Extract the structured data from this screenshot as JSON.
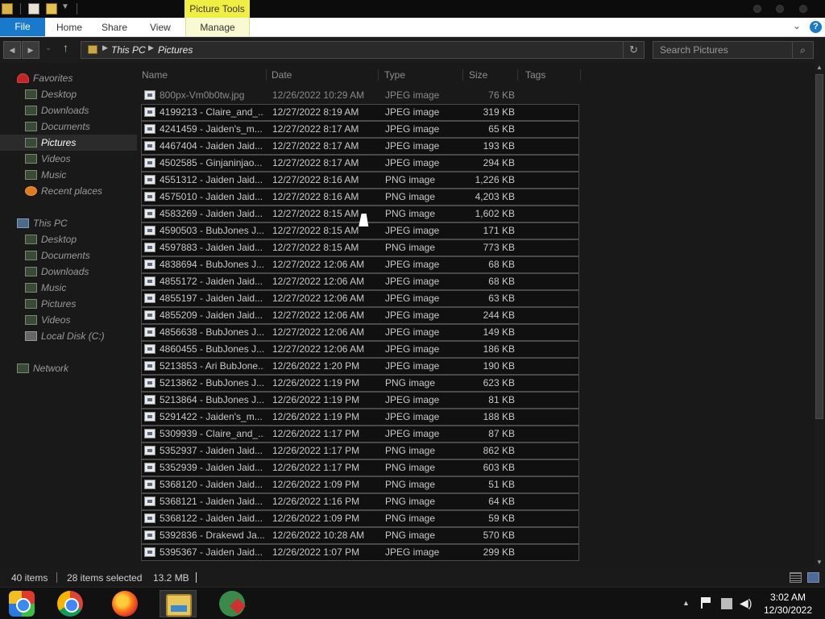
{
  "titlebar": {
    "contextual_tab": "Picture Tools"
  },
  "ribbon": {
    "file_label": "File",
    "tabs": [
      {
        "label": "Home"
      },
      {
        "label": "Share"
      },
      {
        "label": "View"
      },
      {
        "label": "Manage"
      }
    ],
    "help_label": "?"
  },
  "address": {
    "crumbs": [
      {
        "label": "This PC"
      },
      {
        "label": "Pictures"
      }
    ],
    "search_placeholder": "Search Pictures"
  },
  "nav": {
    "favorites_label": "Favorites",
    "favorites": [
      {
        "label": "Desktop"
      },
      {
        "label": "Downloads"
      },
      {
        "label": "Documents"
      },
      {
        "label": "Pictures"
      },
      {
        "label": "Videos"
      },
      {
        "label": "Music"
      },
      {
        "label": "Recent places"
      }
    ],
    "thispc_label": "This PC",
    "thispc": [
      {
        "label": "Desktop"
      },
      {
        "label": "Documents"
      },
      {
        "label": "Downloads"
      },
      {
        "label": "Music"
      },
      {
        "label": "Pictures"
      },
      {
        "label": "Videos"
      },
      {
        "label": "Local Disk (C:)"
      }
    ],
    "network_label": "Network"
  },
  "columns": {
    "name": "Name",
    "date": "Date",
    "type": "Type",
    "size": "Size",
    "tags": "Tags"
  },
  "files": [
    {
      "name": "800px-Vm0b0tw.jpg",
      "date": "12/26/2022 10:29 AM",
      "type": "JPEG image",
      "size": "76 KB",
      "selected": false
    },
    {
      "name": "4199213 - Claire_and_...",
      "date": "12/27/2022 8:19 AM",
      "type": "JPEG image",
      "size": "319 KB",
      "selected": true
    },
    {
      "name": "4241459 - Jaiden's_m...",
      "date": "12/27/2022 8:17 AM",
      "type": "JPEG image",
      "size": "65 KB",
      "selected": true
    },
    {
      "name": "4467404 - Jaiden Jaid...",
      "date": "12/27/2022 8:17 AM",
      "type": "JPEG image",
      "size": "193 KB",
      "selected": true
    },
    {
      "name": "4502585 - Ginjaninjao...",
      "date": "12/27/2022 8:17 AM",
      "type": "JPEG image",
      "size": "294 KB",
      "selected": true
    },
    {
      "name": "4551312 - Jaiden Jaid...",
      "date": "12/27/2022 8:16 AM",
      "type": "PNG image",
      "size": "1,226 KB",
      "selected": true
    },
    {
      "name": "4575010 - Jaiden Jaid...",
      "date": "12/27/2022 8:16 AM",
      "type": "PNG image",
      "size": "4,203 KB",
      "selected": true
    },
    {
      "name": "4583269 - Jaiden Jaid...",
      "date": "12/27/2022 8:15 AM",
      "type": "PNG image",
      "size": "1,602 KB",
      "selected": true
    },
    {
      "name": "4590503 - BubJones J...",
      "date": "12/27/2022 8:15 AM",
      "type": "JPEG image",
      "size": "171 KB",
      "selected": true
    },
    {
      "name": "4597883 - Jaiden Jaid...",
      "date": "12/27/2022 8:15 AM",
      "type": "PNG image",
      "size": "773 KB",
      "selected": true
    },
    {
      "name": "4838694 - BubJones J...",
      "date": "12/27/2022 12:06 AM",
      "type": "JPEG image",
      "size": "68 KB",
      "selected": true
    },
    {
      "name": "4855172 - Jaiden Jaid...",
      "date": "12/27/2022 12:06 AM",
      "type": "JPEG image",
      "size": "68 KB",
      "selected": true
    },
    {
      "name": "4855197 - Jaiden Jaid...",
      "date": "12/27/2022 12:06 AM",
      "type": "JPEG image",
      "size": "63 KB",
      "selected": true
    },
    {
      "name": "4855209 - Jaiden Jaid...",
      "date": "12/27/2022 12:06 AM",
      "type": "JPEG image",
      "size": "244 KB",
      "selected": true
    },
    {
      "name": "4856638 - BubJones J...",
      "date": "12/27/2022 12:06 AM",
      "type": "JPEG image",
      "size": "149 KB",
      "selected": true
    },
    {
      "name": "4860455 - BubJones J...",
      "date": "12/27/2022 12:06 AM",
      "type": "JPEG image",
      "size": "186 KB",
      "selected": true
    },
    {
      "name": "5213853 - Ari BubJone...",
      "date": "12/26/2022 1:20 PM",
      "type": "JPEG image",
      "size": "190 KB",
      "selected": true
    },
    {
      "name": "5213862 - BubJones J...",
      "date": "12/26/2022 1:19 PM",
      "type": "PNG image",
      "size": "623 KB",
      "selected": true
    },
    {
      "name": "5213864 - BubJones J...",
      "date": "12/26/2022 1:19 PM",
      "type": "JPEG image",
      "size": "81 KB",
      "selected": true
    },
    {
      "name": "5291422 - Jaiden's_m...",
      "date": "12/26/2022 1:19 PM",
      "type": "JPEG image",
      "size": "188 KB",
      "selected": true
    },
    {
      "name": "5309939 - Claire_and_...",
      "date": "12/26/2022 1:17 PM",
      "type": "JPEG image",
      "size": "87 KB",
      "selected": true
    },
    {
      "name": "5352937 - Jaiden Jaid...",
      "date": "12/26/2022 1:17 PM",
      "type": "PNG image",
      "size": "862 KB",
      "selected": true
    },
    {
      "name": "5352939 - Jaiden Jaid...",
      "date": "12/26/2022 1:17 PM",
      "type": "PNG image",
      "size": "603 KB",
      "selected": true
    },
    {
      "name": "5368120 - Jaiden Jaid...",
      "date": "12/26/2022 1:09 PM",
      "type": "PNG image",
      "size": "51 KB",
      "selected": true
    },
    {
      "name": "5368121 - Jaiden Jaid...",
      "date": "12/26/2022 1:16 PM",
      "type": "PNG image",
      "size": "64 KB",
      "selected": true
    },
    {
      "name": "5368122 - Jaiden Jaid...",
      "date": "12/26/2022 1:09 PM",
      "type": "PNG image",
      "size": "59 KB",
      "selected": true
    },
    {
      "name": "5392836 - Drakewd Ja...",
      "date": "12/26/2022 10:28 AM",
      "type": "PNG image",
      "size": "570 KB",
      "selected": true
    },
    {
      "name": "5395367 - Jaiden Jaid...",
      "date": "12/26/2022 1:07 PM",
      "type": "JPEG image",
      "size": "299 KB",
      "selected": true
    }
  ],
  "status": {
    "count": "40 items",
    "selected": "28 items selected",
    "size": "13.2 MB"
  },
  "clock": {
    "time": "3:02 AM",
    "date": "12/30/2022"
  },
  "colors": {
    "accent": "#1979ca",
    "contextual_tab": "#eeee44",
    "background": "#191919"
  }
}
